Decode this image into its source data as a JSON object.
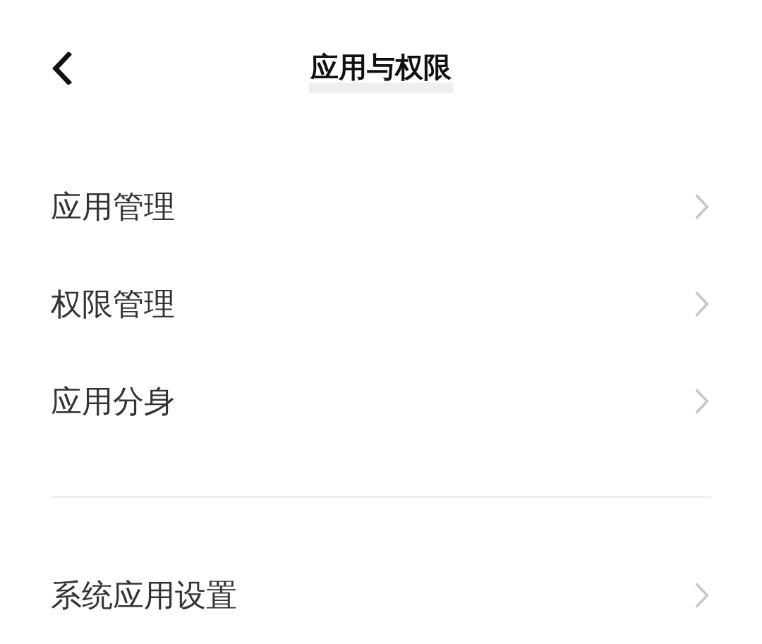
{
  "header": {
    "title": "应用与权限"
  },
  "sections": [
    {
      "items": [
        {
          "label": "应用管理"
        },
        {
          "label": "权限管理"
        },
        {
          "label": "应用分身"
        }
      ]
    },
    {
      "items": [
        {
          "label": "系统应用设置"
        }
      ]
    }
  ]
}
